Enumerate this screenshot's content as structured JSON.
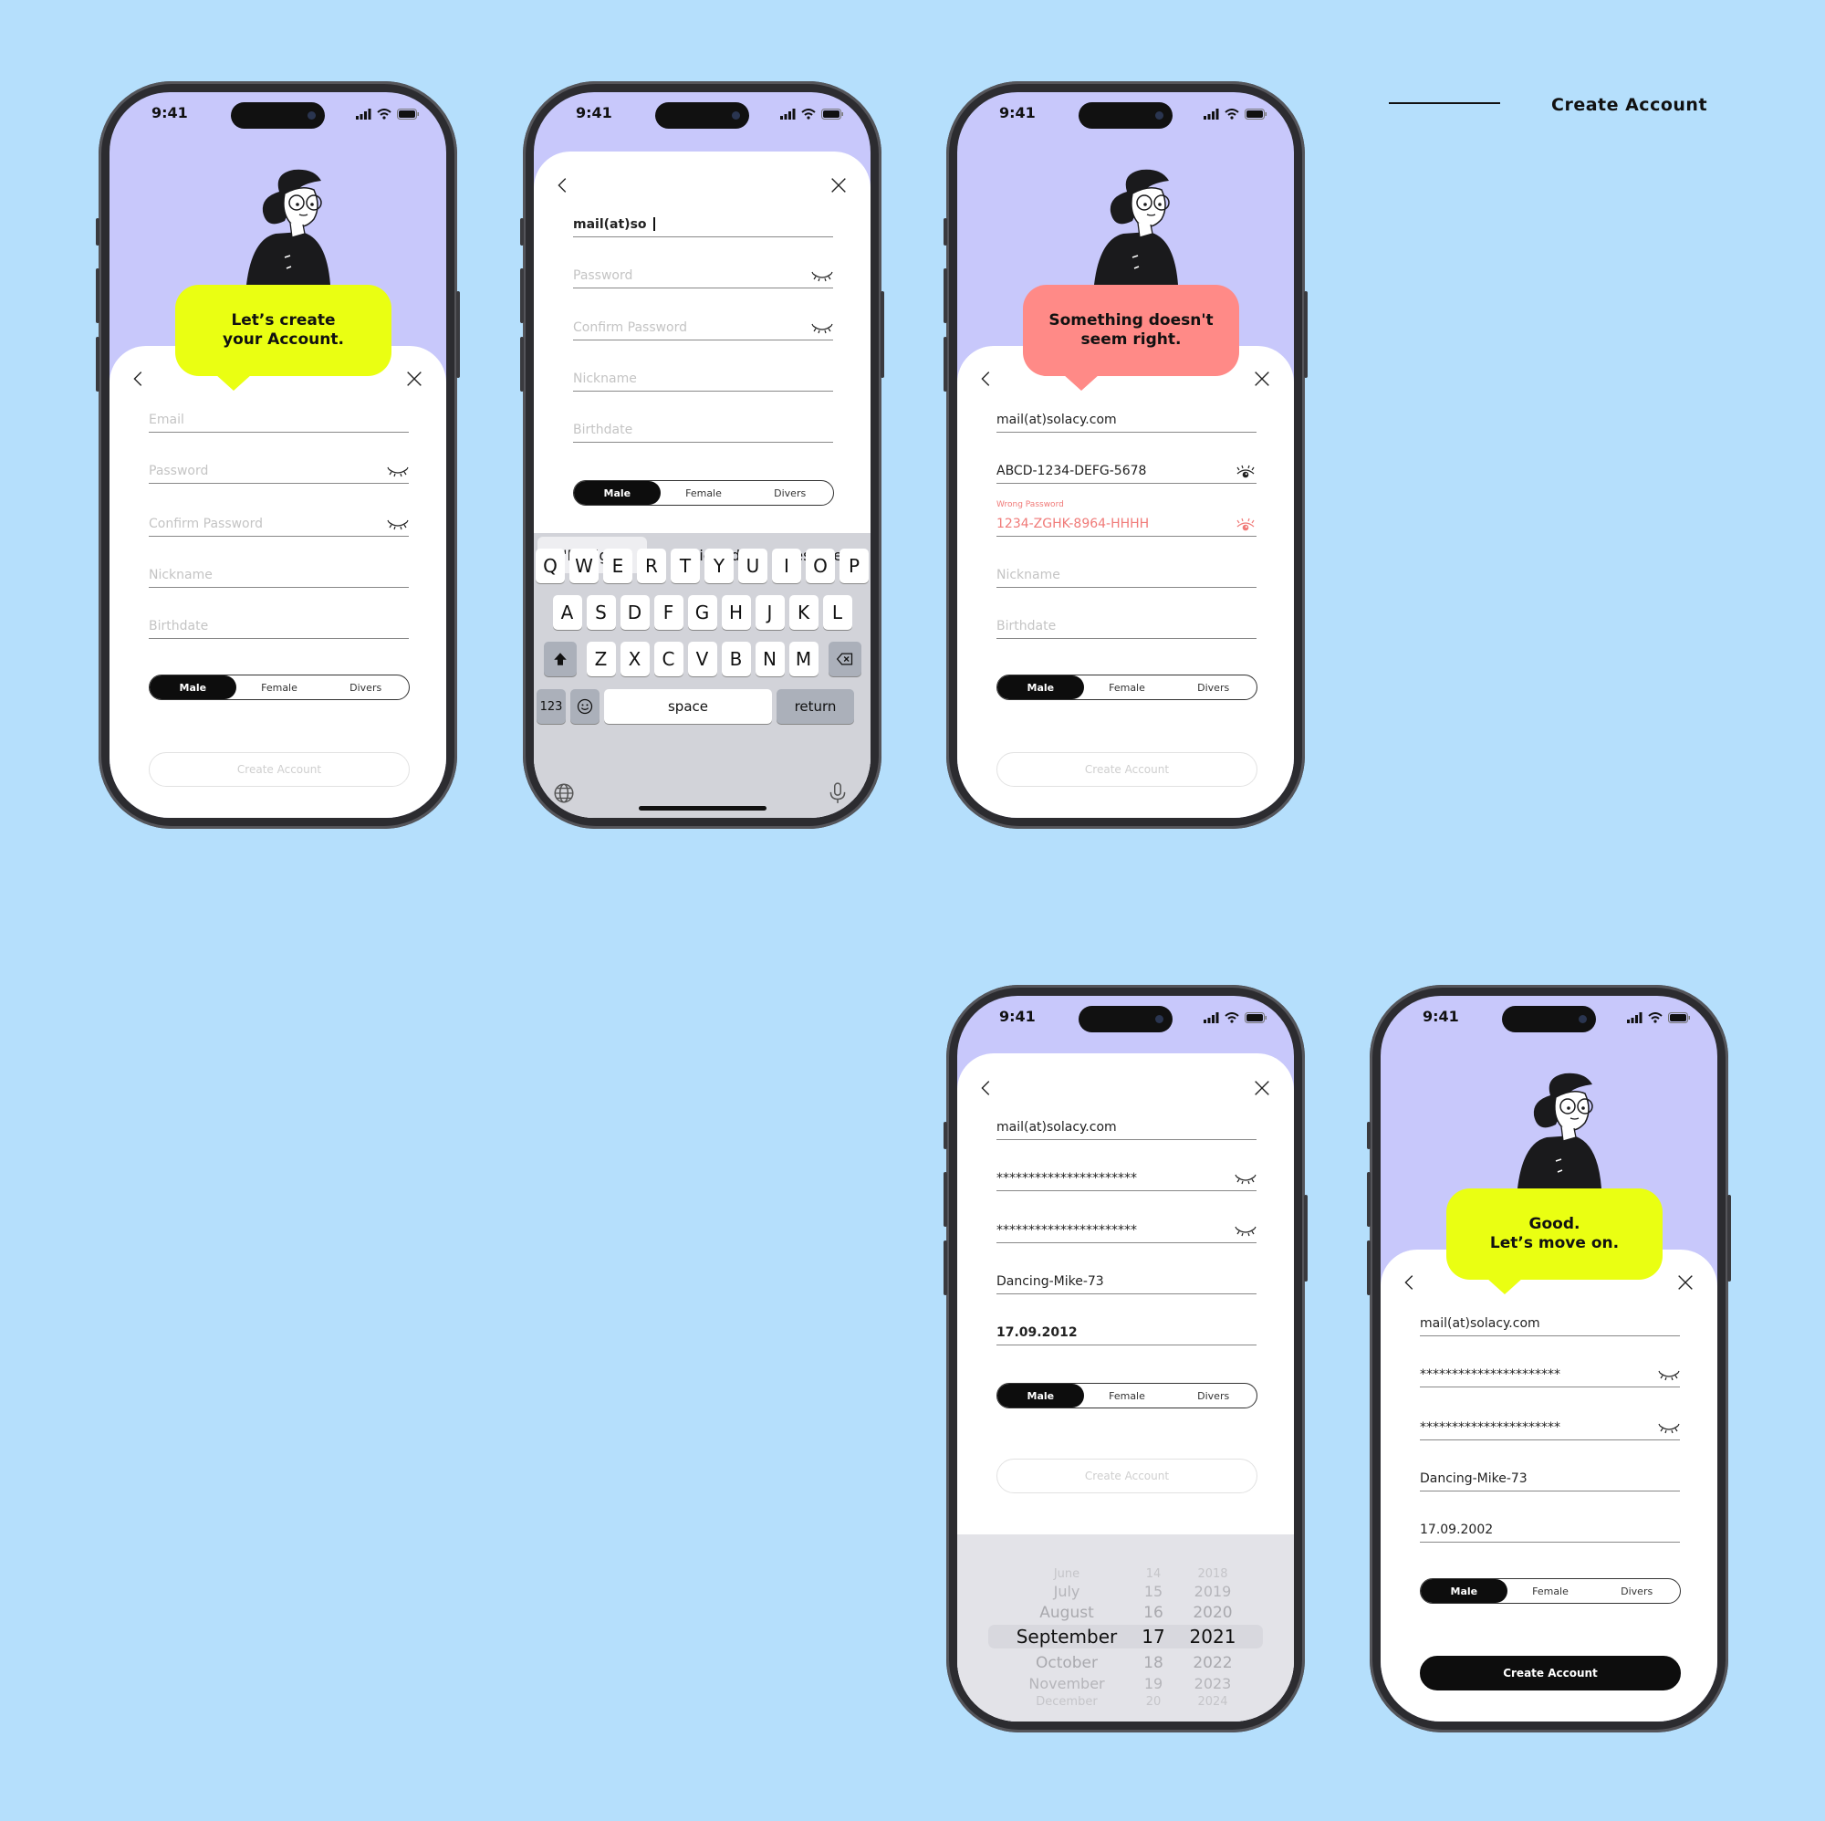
{
  "page_title": "Create Account",
  "colors": {
    "background": "#b5dffc",
    "header_purple": "#c8c8fb",
    "bubble_yellow": "#eaff12",
    "bubble_error": "#ff8a87",
    "error_text": "#f07a78",
    "primary": "#0d0d0d"
  },
  "status": {
    "time": "9:41"
  },
  "phones": [
    {
      "bubble": "Let’s create\nyour Account.",
      "bubble_color": "#eaff12",
      "fields": [
        {
          "placeholder": "Email",
          "value": ""
        },
        {
          "placeholder": "Password",
          "value": "",
          "eye": "eye-closed"
        },
        {
          "placeholder": "Confirm Password",
          "value": "",
          "eye": "eye-closed"
        },
        {
          "placeholder": "Nickname",
          "value": ""
        },
        {
          "placeholder": "Birthdate",
          "value": ""
        }
      ],
      "gender": {
        "options": [
          "Male",
          "Female",
          "Divers"
        ],
        "selected": "Male"
      },
      "create_label": "Create Account",
      "create_enabled": false
    },
    {
      "fields": [
        {
          "placeholder": "Email",
          "value": "mail(at)so",
          "focused": true
        },
        {
          "placeholder": "Password",
          "value": "",
          "eye": "eye-closed"
        },
        {
          "placeholder": "Confirm Password",
          "value": "",
          "eye": "eye-closed"
        },
        {
          "placeholder": "Nickname",
          "value": ""
        },
        {
          "placeholder": "Birthdate",
          "value": ""
        }
      ],
      "gender": {
        "options": [
          "Male",
          "Female",
          "Divers"
        ],
        "selected": "Male"
      },
      "keyboard": {
        "suggestions": [
          "\"Design\"",
          "Designed",
          "Designer"
        ],
        "rows": [
          [
            "Q",
            "W",
            "E",
            "R",
            "T",
            "Y",
            "U",
            "I",
            "O",
            "P"
          ],
          [
            "A",
            "S",
            "D",
            "F",
            "G",
            "H",
            "J",
            "K",
            "L"
          ],
          [
            "Z",
            "X",
            "C",
            "V",
            "B",
            "N",
            "M"
          ]
        ],
        "numbers_label": "123",
        "space_label": "space",
        "return_label": "return"
      }
    },
    {
      "bubble": "Something doesn't\nseem right.",
      "bubble_color": "#ff8a87",
      "fields": [
        {
          "placeholder": "Email",
          "value": "mail(at)solacy.com"
        },
        {
          "placeholder": "Password",
          "value": "ABCD-1234-DEFG-5678",
          "eye": "eye-open"
        },
        {
          "placeholder": "Confirm Password",
          "value": "1234-ZGHK-8964-HHHH",
          "eye": "eye-open",
          "error": "Wrong Password"
        },
        {
          "placeholder": "Nickname",
          "value": ""
        },
        {
          "placeholder": "Birthdate",
          "value": ""
        }
      ],
      "gender": {
        "options": [
          "Male",
          "Female",
          "Divers"
        ],
        "selected": "Male"
      },
      "create_label": "Create Account",
      "create_enabled": false
    },
    {
      "fields": [
        {
          "placeholder": "Email",
          "value": "mail(at)solacy.com"
        },
        {
          "placeholder": "Password",
          "value": "**********************",
          "eye": "eye-closed"
        },
        {
          "placeholder": "Confirm Password",
          "value": "**********************",
          "eye": "eye-closed"
        },
        {
          "placeholder": "Nickname",
          "value": "Dancing-Mike-73"
        },
        {
          "placeholder": "Birthdate",
          "value": "17.09.2012",
          "focused": true
        }
      ],
      "gender": {
        "options": [
          "Male",
          "Female",
          "Divers"
        ],
        "selected": "Male"
      },
      "create_label": "Create Account",
      "create_enabled": false,
      "date_picker": {
        "months": [
          "June",
          "July",
          "August",
          "September",
          "October",
          "November",
          "December"
        ],
        "days": [
          "14",
          "15",
          "16",
          "17",
          "18",
          "19",
          "20"
        ],
        "years": [
          "2018",
          "2019",
          "2020",
          "2021",
          "2022",
          "2023",
          "2024"
        ],
        "selected_index": 3
      }
    },
    {
      "bubble": "Good.\nLet’s move on.",
      "bubble_color": "#eaff12",
      "fields": [
        {
          "placeholder": "Email",
          "value": "mail(at)solacy.com"
        },
        {
          "placeholder": "Password",
          "value": "**********************",
          "eye": "eye-closed"
        },
        {
          "placeholder": "Confirm Password",
          "value": "**********************",
          "eye": "eye-closed"
        },
        {
          "placeholder": "Nickname",
          "value": "Dancing-Mike-73"
        },
        {
          "placeholder": "Birthdate",
          "value": "17.09.2002"
        }
      ],
      "gender": {
        "options": [
          "Male",
          "Female",
          "Divers"
        ],
        "selected": "Male"
      },
      "create_label": "Create Account",
      "create_enabled": true
    }
  ]
}
